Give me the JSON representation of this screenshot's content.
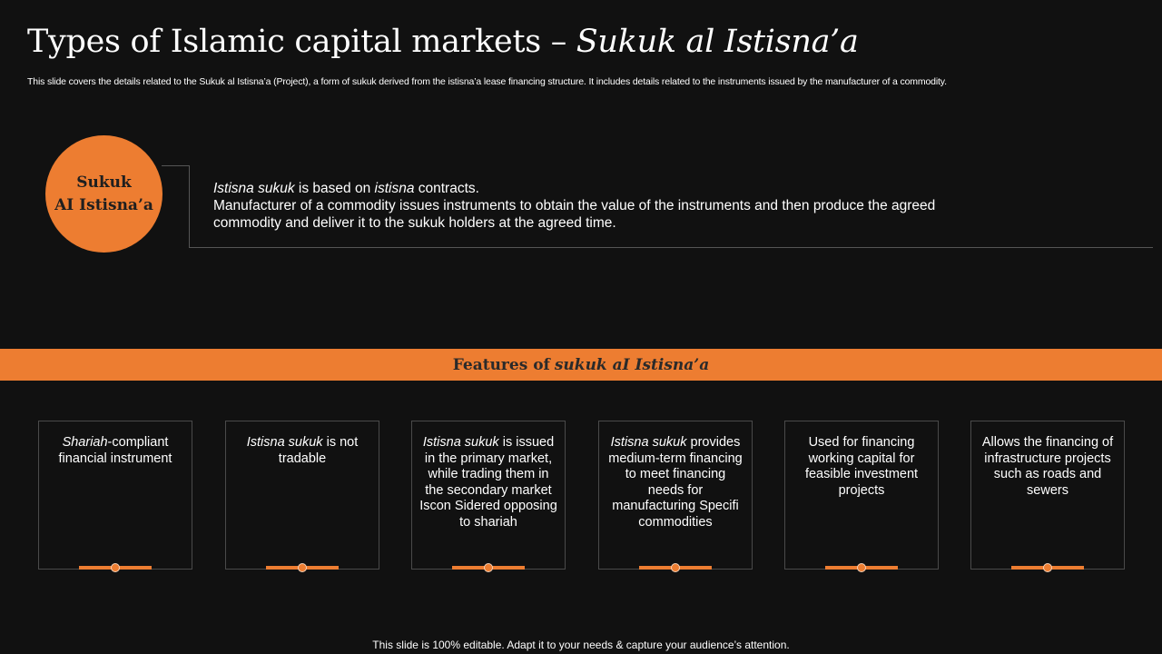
{
  "title": {
    "main": "Types of Islamic capital markets –",
    "italic": "Sukuk al Istisna’a"
  },
  "subtitle": "This slide covers the details related to the Sukuk al Istisna’a (Project), a form of sukuk derived from the istisna’a lease financing structure. It includes details related to the instruments issued by the manufacturer of a commodity.",
  "circle": {
    "line1": "Sukuk",
    "line2": "AI Istisna’a",
    "color": "#ed7d31"
  },
  "description": {
    "term1": "Istisna sukuk",
    "text1": " is based on ",
    "term2": "istisna",
    "text2": " contracts.",
    "line2": "Manufacturer  of a commodity issues instruments  to obtain the value  of the instruments  and then produce the agreed commodity and deliver it to the sukuk holders at the agreed time."
  },
  "banner": {
    "prefix": "Features of",
    "italic": "sukuk aI Istisna’a"
  },
  "cards": [
    {
      "italic": "Shariah",
      "text": "-compliant financial instrument"
    },
    {
      "italic": "Istisna sukuk",
      "text": " is not tradable"
    },
    {
      "italic": "Istisna sukuk",
      "text": " is issued in the primary market, while trading them in the secondary market Iscon Sidered opposing to shariah"
    },
    {
      "italic": "Istisna sukuk",
      "text": " provides medium-term financing to meet financing needs for manufacturing Specifi commodities"
    },
    {
      "italic": "",
      "text": "Used for financing working capital for feasible investment projects"
    },
    {
      "italic": "",
      "text": "Allows the financing of infrastructure projects such as roads and sewers"
    }
  ],
  "footer": "This slide is 100% editable. Adapt it to your needs & capture your audience’s attention.",
  "colors": {
    "accent": "#ed7d31",
    "background": "#111111"
  }
}
